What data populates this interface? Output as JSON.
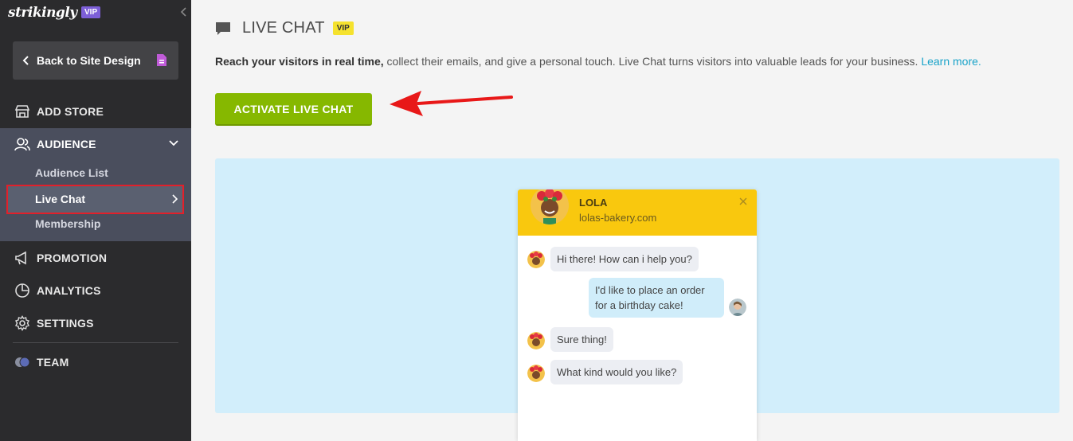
{
  "sidebar": {
    "logo": "strikingly",
    "vip": "VIP",
    "back_label": "Back to Site Design",
    "nav": {
      "add_store": "ADD STORE",
      "audience": "AUDIENCE",
      "audience_list": "Audience List",
      "live_chat": "Live Chat",
      "membership": "Membership",
      "promotion": "PROMOTION",
      "analytics": "ANALYTICS",
      "settings": "SETTINGS",
      "team": "TEAM"
    }
  },
  "main": {
    "title": "LIVE CHAT",
    "vip": "VIP",
    "description_bold": "Reach your visitors in real time,",
    "description_rest": " collect their emails, and give a personal touch. Live Chat turns visitors into valuable leads for your business. ",
    "learn_more": "Learn more.",
    "activate_label": "ACTIVATE LIVE CHAT"
  },
  "chat_preview": {
    "name": "LOLA",
    "site": "lolas-bakery.com",
    "messages": [
      {
        "from": "lola",
        "text": "Hi there! How can i help you?"
      },
      {
        "from": "visitor",
        "text_line1": "I'd like to place an order",
        "text_line2": "for a birthday cake!"
      },
      {
        "from": "lola",
        "text": "Sure thing!"
      },
      {
        "from": "lola",
        "text": "What kind would you like?"
      }
    ]
  },
  "colors": {
    "sidebar_bg": "#2b2b2d",
    "audience_bg": "#4a4e5d",
    "activate_green": "#86b800",
    "preview_bg": "#d2eefb",
    "chat_header_yellow": "#f9c80e",
    "highlight_red": "#e2202a",
    "link_blue": "#1aa3c9"
  }
}
